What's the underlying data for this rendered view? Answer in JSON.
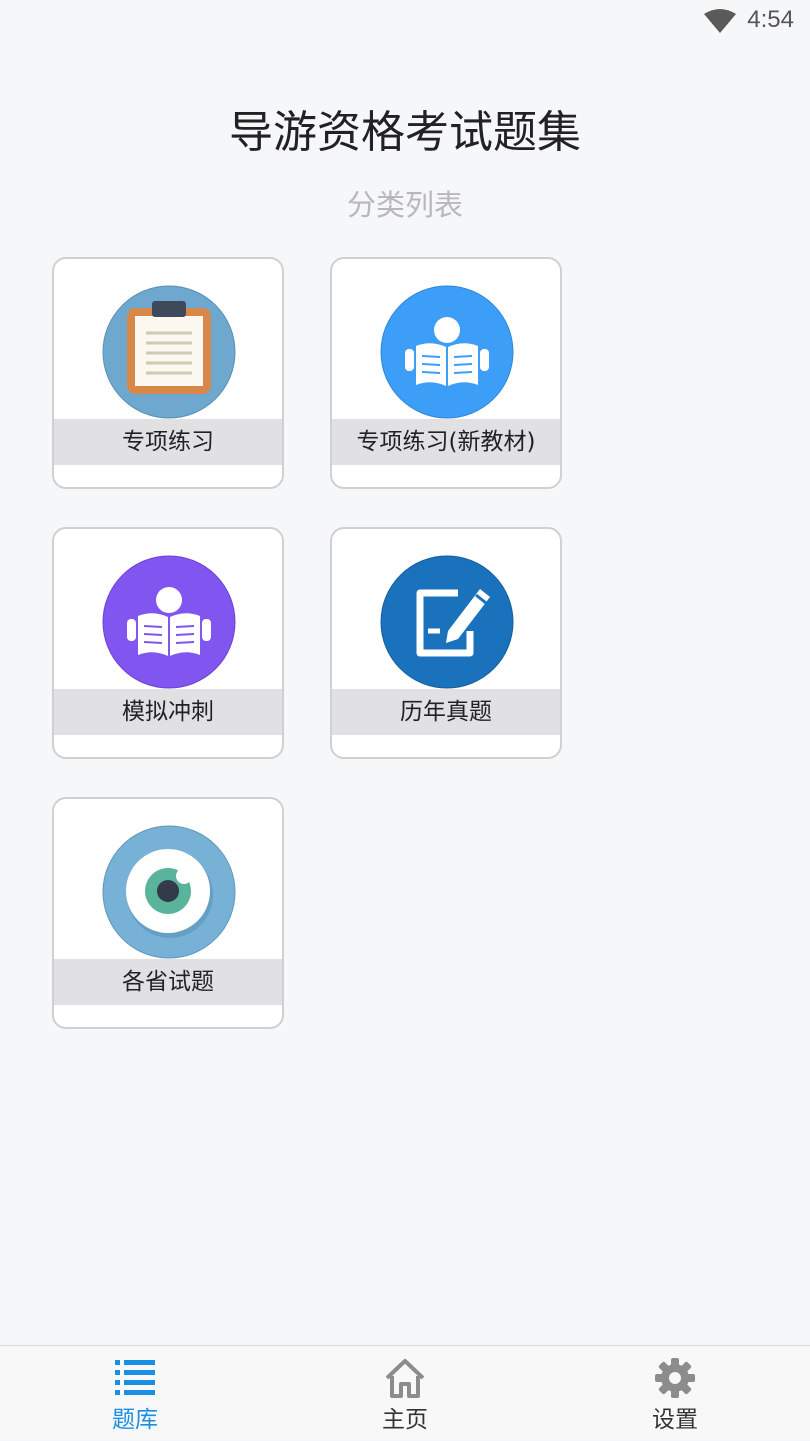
{
  "status_bar": {
    "time": "4:54",
    "wifi_icon": "wifi-icon"
  },
  "header": {
    "title": "导游资格考试题集",
    "subtitle": "分类列表"
  },
  "categories": [
    {
      "label": "专项练习",
      "icon": "clipboard-icon",
      "icon_bg": "#6fa8cf"
    },
    {
      "label": "专项练习(新教材)",
      "icon": "reading-person-icon",
      "icon_bg": "#3d9ef7"
    },
    {
      "label": "模拟冲刺",
      "icon": "reading-person-icon",
      "icon_bg": "#8155ef"
    },
    {
      "label": "历年真题",
      "icon": "edit-pen-icon",
      "icon_bg": "#1a72bd"
    },
    {
      "label": "各省试题",
      "icon": "eye-icon",
      "icon_bg": "#77b2d6"
    }
  ],
  "bottom_nav": {
    "active_color": "#1a8fe3",
    "items": [
      {
        "label": "题库",
        "icon": "list-icon",
        "active": true
      },
      {
        "label": "主页",
        "icon": "home-icon",
        "active": false
      },
      {
        "label": "设置",
        "icon": "gear-icon",
        "active": false
      }
    ]
  }
}
